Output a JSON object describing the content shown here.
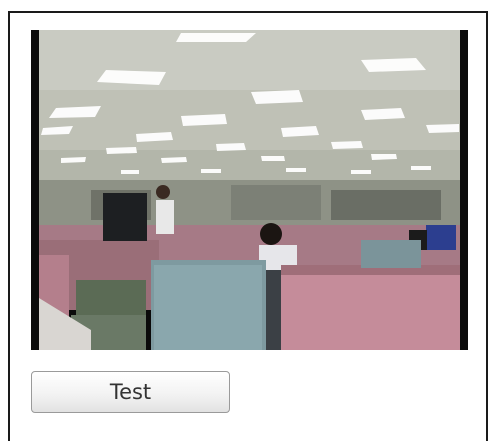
{
  "camera_view": {
    "icon": "camera-feed-image",
    "description_visible": false
  },
  "actions": {
    "test_label": "Test"
  },
  "colors": {
    "panel_border": "#1a1a1a",
    "button_border": "#9a9a9a",
    "button_text": "#333333",
    "video_frame": "#0b0b0b"
  }
}
